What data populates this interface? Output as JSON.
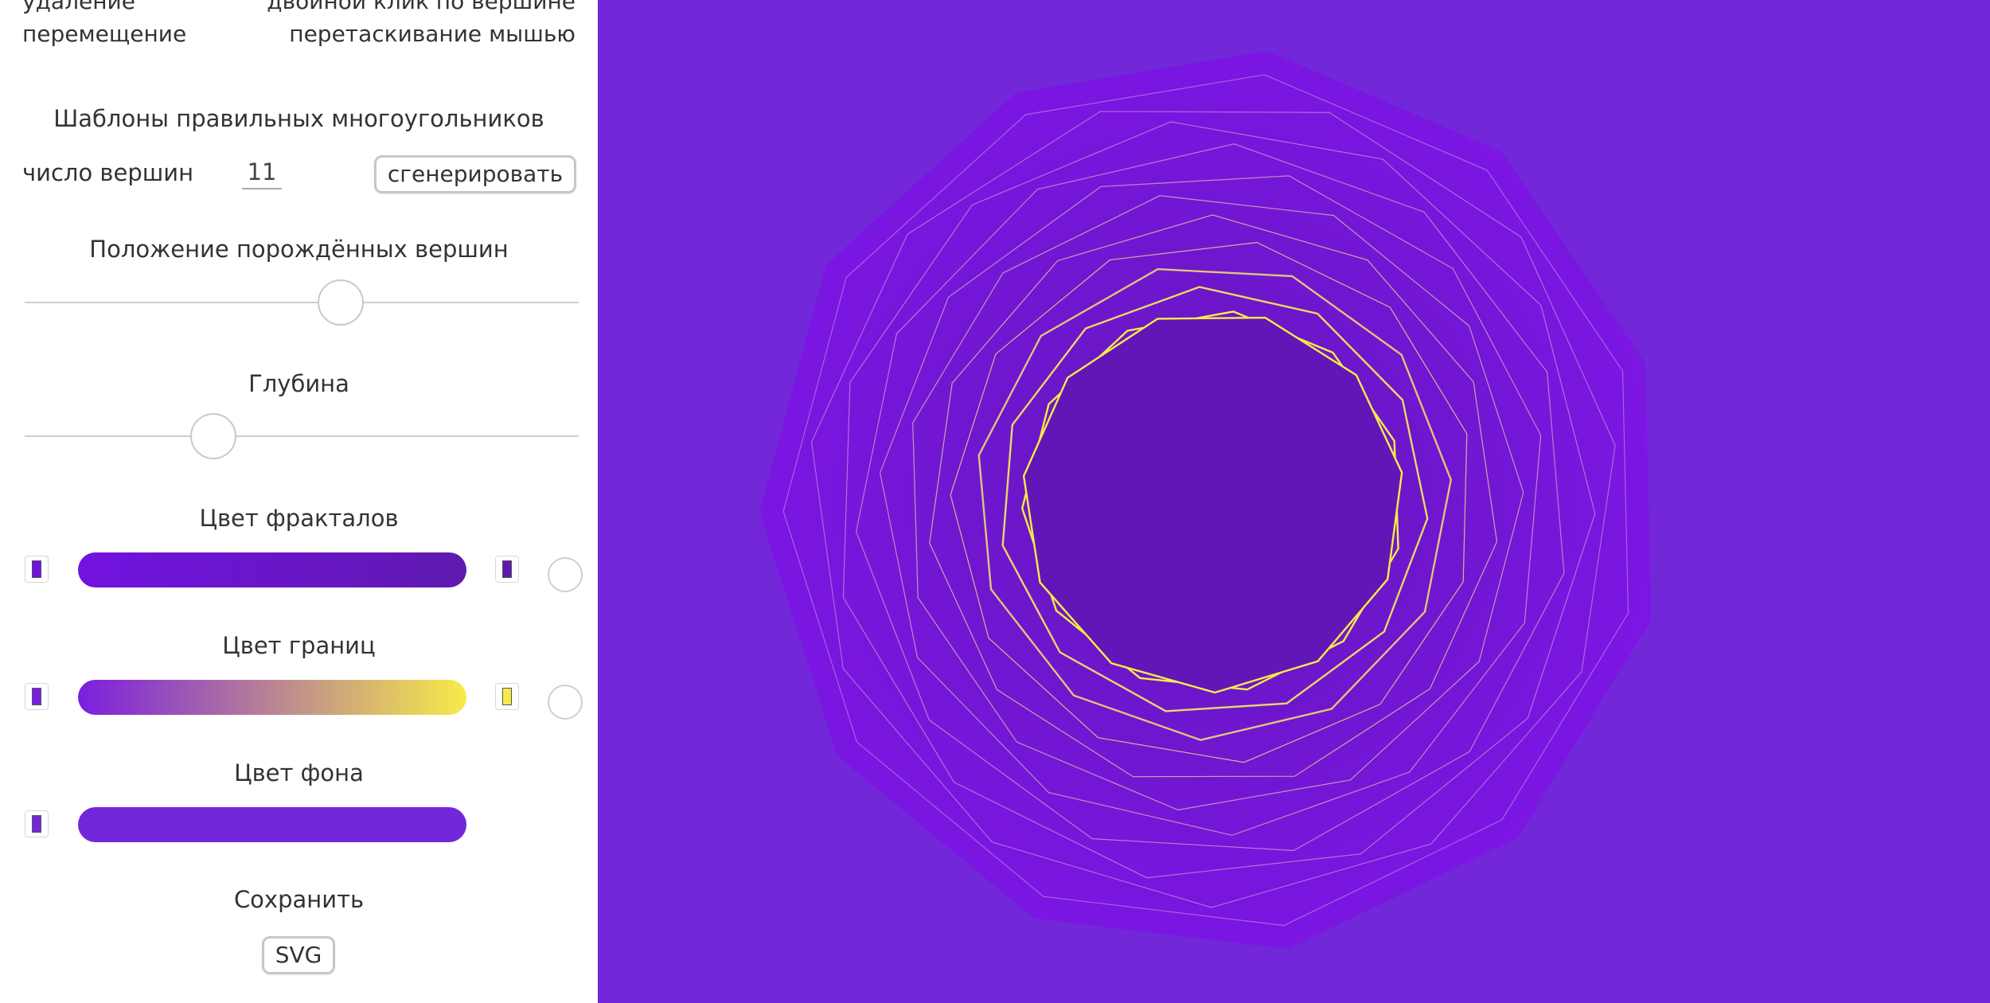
{
  "panel": {
    "hints": [
      {
        "key": "удаление",
        "value": "двойной клик по вершине"
      },
      {
        "key": "перемещение",
        "value": "перетаскивание мышью"
      }
    ],
    "templates": {
      "heading": "Шаблоны правильных многоугольников",
      "vertices_label": "число вершин",
      "vertices_value": "11",
      "generate_label": "сгенерировать"
    },
    "position": {
      "heading": "Положение порождённых вершин",
      "value": 0.57
    },
    "depth": {
      "heading": "Глубина",
      "value": 0.34
    },
    "fractal_color": {
      "heading": "Цвет фракталов",
      "from": "#7212e0",
      "to": "#5f1ab0"
    },
    "border_color": {
      "heading": "Цвет границ",
      "from": "#7a1ee0",
      "to": "#f7eb48"
    },
    "background_color": {
      "heading": "Цвет фона",
      "from": "#7227d8",
      "to": "#7227d8"
    },
    "save": {
      "heading": "Сохранить",
      "svg_label": "SVG"
    }
  },
  "canvas": {
    "background": "#7227d8",
    "fractal_outer": "#7b16e3",
    "fractal_inner": "#6216b8",
    "edge_inner": "#f7eb48",
    "edge_outer": "#c9a3e6",
    "vertex_count": 11
  }
}
